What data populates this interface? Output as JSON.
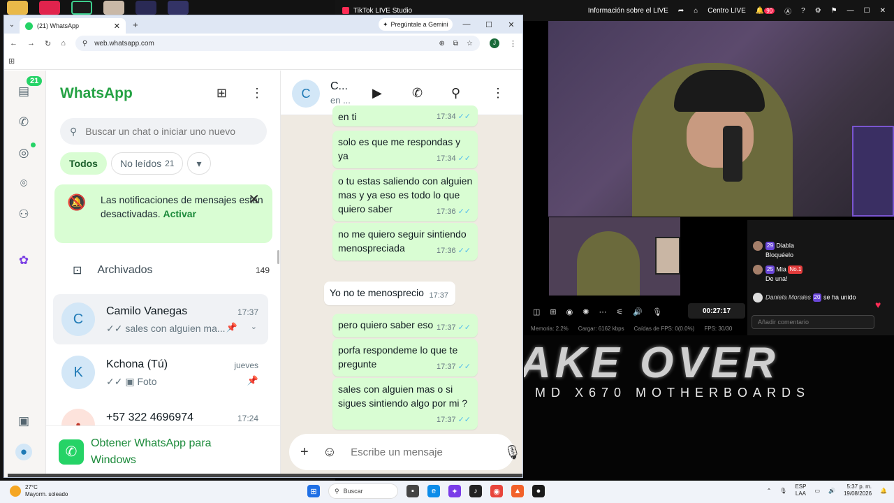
{
  "browser": {
    "tab_title": "(21) WhatsApp",
    "gemini_label": "Pregúntale a Gemini",
    "url": "web.whatsapp.com",
    "profile_initial": "J"
  },
  "whatsapp": {
    "app_title": "WhatsApp",
    "rail_badge": "21",
    "search_placeholder": "Buscar un chat o iniciar uno nuevo",
    "filters": {
      "all": "Todos",
      "unread": "No leídos",
      "unread_count": "21"
    },
    "notification": {
      "text": "Las notificaciones de mensajes están desactivadas.",
      "action": "Activar"
    },
    "archived": {
      "label": "Archivados",
      "count": "149"
    },
    "chats": [
      {
        "initial": "C",
        "name": "Camilo Vanegas",
        "time": "17:37",
        "preview": "✓✓ sales con alguien ma..."
      },
      {
        "initial": "K",
        "name": "Kchona (Tú)",
        "time": "jueves",
        "preview": "✓✓ ▣ Foto"
      },
      {
        "initial": "•",
        "name": "+57 322 4696974",
        "time": "17:24",
        "preview": ""
      }
    ],
    "get_app": "Obtener WhatsApp para Windows"
  },
  "conversation": {
    "initial": "C",
    "name": "C...",
    "status": "en ...",
    "messages": [
      {
        "text": "en ti",
        "time": "17:34",
        "dir": "out"
      },
      {
        "text": "solo es que me respondas y ya",
        "time": "17:34",
        "dir": "out"
      },
      {
        "text": "o tu estas saliendo con alguien mas y ya eso es todo lo que quiero saber",
        "time": "17:36",
        "dir": "out"
      },
      {
        "text": "no me quiero seguir sintiendo menospreciada",
        "time": "17:36",
        "dir": "out"
      },
      {
        "text": "Yo no te menosprecio",
        "time": "17:37",
        "dir": "in"
      },
      {
        "text": "pero quiero saber eso",
        "time": "17:37",
        "dir": "out"
      },
      {
        "text": "porfa respondeme lo que te pregunte",
        "time": "17:37",
        "dir": "out"
      },
      {
        "text": "sales con alguien mas o si sigues sintiendo algo por mi ?",
        "time": "17:37",
        "dir": "out"
      }
    ],
    "composer_placeholder": "Escribe un mensaje"
  },
  "tiktok": {
    "title": "TikTok LIVE Studio",
    "live_info": "Información sobre el LIVE",
    "center": "Centro LIVE",
    "notif_count": "90",
    "timer": "00:27:17",
    "stats": {
      "memory": "Memoria: 2.2%",
      "upload": "Cargar: 6162 kbps",
      "fps_drops": "Caídas de FPS: 0(0.0%)",
      "fps": "FPS: 30/30"
    },
    "comments": [
      {
        "user": "29",
        "name": "Diabla",
        "text": "Bloquéelo"
      },
      {
        "user": "25",
        "name": "Mia",
        "badge": "No.1",
        "text": "De una!"
      },
      {
        "user": "Daniela Morales",
        "level": "20",
        "text": "se ha unido"
      }
    ],
    "comment_placeholder": "Añadir comentario",
    "banner_big": "AKE OVER",
    "banner_small": "MD X670 MOTHERBOARDS"
  },
  "taskbar": {
    "temp": "27°C",
    "weather": "Mayorm. soleado",
    "search": "Buscar",
    "lang_top": "ESP",
    "lang_bottom": "LAA",
    "time": "5:37 p. m.",
    "date": "19/08/2026"
  },
  "colors": {
    "wa_green": "#25d366",
    "bubble_out": "#d9fdd3",
    "tiktok_red": "#fe2c55"
  }
}
